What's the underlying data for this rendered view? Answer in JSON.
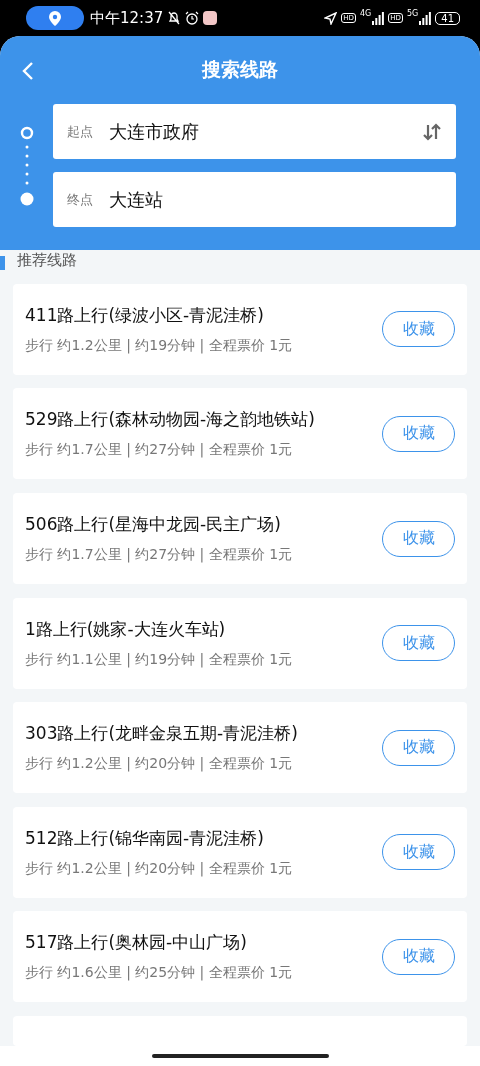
{
  "status_bar": {
    "time": "中午12:37",
    "hd_1": "HD",
    "network_1": "4G",
    "hd_2": "HD",
    "network_2": "5G",
    "battery": "41"
  },
  "header": {
    "title": "搜索线路"
  },
  "route": {
    "start": {
      "label": "起点",
      "value": "大连市政府"
    },
    "end": {
      "label": "终点",
      "value": "大连站"
    }
  },
  "section": {
    "title": "推荐线路"
  },
  "routes": [
    {
      "name": "411路上行(绿波小区-青泥洼桥)",
      "info": "步行 约1.2公里 | 约19分钟 | 全程票价 1元",
      "button": "收藏"
    },
    {
      "name": "529路上行(森林动物园-海之韵地铁站)",
      "info": "步行 约1.7公里 | 约27分钟 | 全程票价 1元",
      "button": "收藏"
    },
    {
      "name": "506路上行(星海中龙园-民主广场)",
      "info": "步行 约1.7公里 | 约27分钟 | 全程票价 1元",
      "button": "收藏"
    },
    {
      "name": "1路上行(姚家-大连火车站)",
      "info": "步行 约1.1公里 | 约19分钟 | 全程票价 1元",
      "button": "收藏"
    },
    {
      "name": "303路上行(龙畔金泉五期-青泥洼桥)",
      "info": "步行 约1.2公里 | 约20分钟 | 全程票价 1元",
      "button": "收藏"
    },
    {
      "name": "512路上行(锦华南园-青泥洼桥)",
      "info": "步行 约1.2公里 | 约20分钟 | 全程票价 1元",
      "button": "收藏"
    },
    {
      "name": "517路上行(奥林园-中山广场)",
      "info": "步行 约1.6公里 | 约25分钟 | 全程票价 1元",
      "button": "收藏"
    }
  ]
}
